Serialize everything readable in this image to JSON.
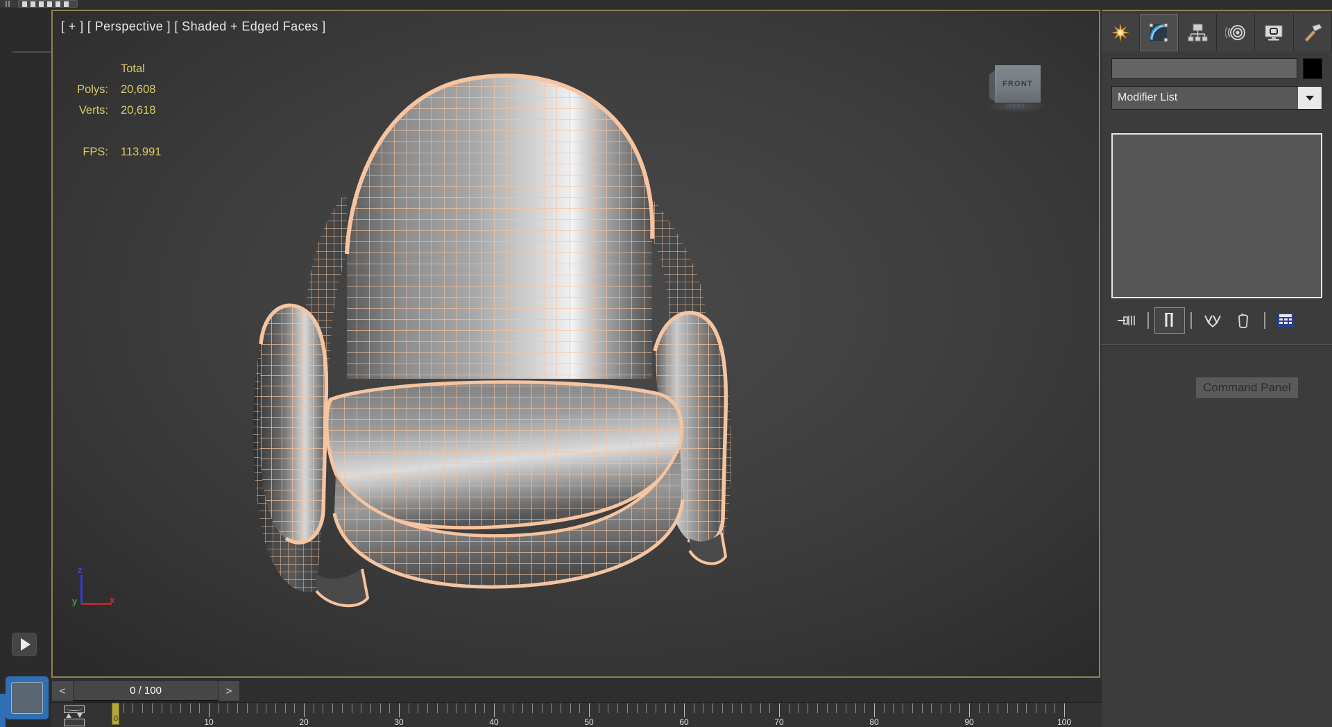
{
  "viewport": {
    "label": "[ + ] [ Perspective ] [ Shaded + Edged Faces ]",
    "stats": {
      "header": "Total",
      "polys_label": "Polys:",
      "polys_value": "20,608",
      "verts_label": "Verts:",
      "verts_value": "20,618",
      "fps_label": "FPS:",
      "fps_value": "113.991"
    },
    "viewcube": {
      "face_label": "FRONT",
      "base_label": "WEST"
    },
    "axis_tripod": {
      "z": "z",
      "x": "x",
      "y": "y"
    },
    "colors": {
      "border": "#8f8152",
      "stats_text": "#d8c96a",
      "label_text": "#e6e6e6",
      "wireframe": "#f5c4a0",
      "background": "#3d3d3d"
    }
  },
  "timebar": {
    "prev_label": "<",
    "next_label": ">",
    "current_frame": "0 / 100",
    "ruler_labels": [
      "0",
      "10",
      "20",
      "30",
      "40",
      "50",
      "60",
      "70",
      "80",
      "90",
      "100"
    ],
    "ruler_min": 0,
    "ruler_max": 100,
    "slider_frame": 0,
    "track_icon": "track-view-icon"
  },
  "left_strip": {
    "play_button": "play-icon",
    "panel_tab": "blue-panel-tab"
  },
  "command_panel": {
    "tooltip": "Command Panel",
    "tabs": [
      {
        "name": "create-tab",
        "icon": "star-icon",
        "active": false
      },
      {
        "name": "modify-tab",
        "icon": "arc-icon",
        "active": true
      },
      {
        "name": "hierarchy-tab",
        "icon": "hierarchy-icon",
        "active": false
      },
      {
        "name": "motion-tab",
        "icon": "motion-icon",
        "active": false
      },
      {
        "name": "display-tab",
        "icon": "monitor-icon",
        "active": false
      },
      {
        "name": "utilities-tab",
        "icon": "hammer-icon",
        "active": false
      }
    ],
    "object_name": "",
    "object_name_placeholder": "",
    "color_swatch": "#000000",
    "modifier_list_label": "Modifier List",
    "modifier_stack_items": [],
    "stack_buttons": [
      {
        "name": "pin-stack-button",
        "icon": "pin-stack-icon",
        "active": false
      },
      {
        "name": "show-end-result-button",
        "icon": "show-end-result-icon",
        "active": true
      },
      {
        "name": "make-unique-button",
        "icon": "make-unique-icon",
        "active": false
      },
      {
        "name": "remove-modifier-button",
        "icon": "trash-icon",
        "active": false
      },
      {
        "name": "configure-sets-button",
        "icon": "configure-sets-icon",
        "active": false
      }
    ]
  }
}
